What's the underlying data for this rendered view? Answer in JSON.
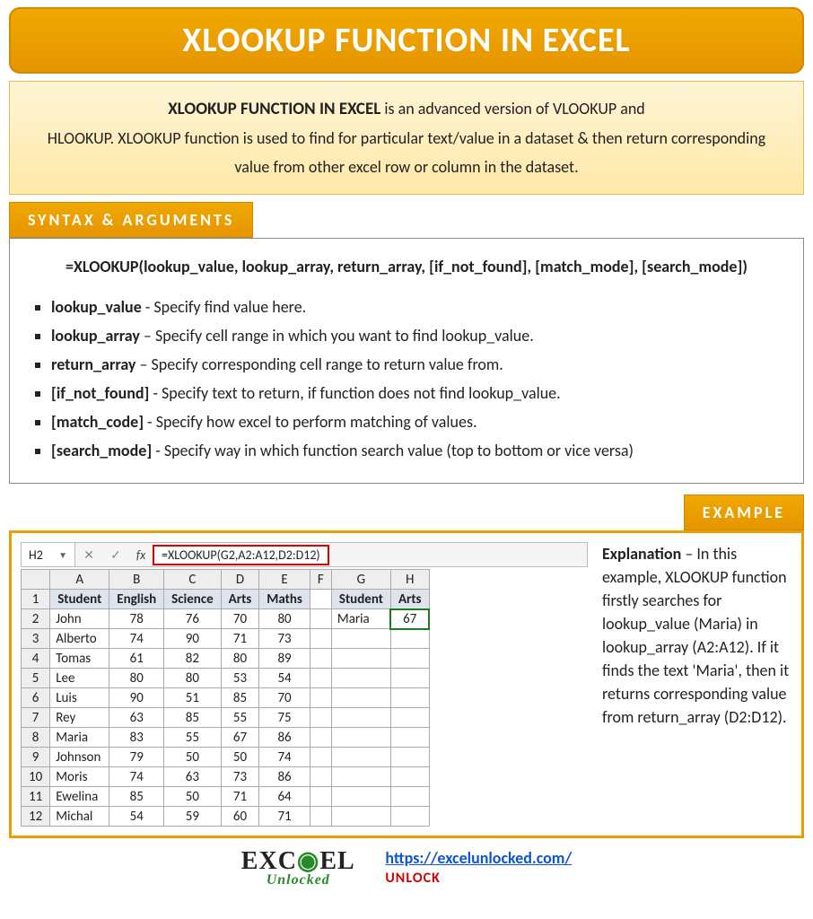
{
  "banner_title": "XLOOKUP FUNCTION IN EXCEL",
  "desc": {
    "lead": "XLOOKUP FUNCTION IN EXCEL",
    "rest1": " is an advanced version of VLOOKUP and",
    "rest2": "HLOOKUP. XLOOKUP function is used to find for particular text/value in a dataset & then return corresponding value from other excel row or column in the dataset."
  },
  "tabs": {
    "syntax": "SYNTAX & ARGUMENTS",
    "example": "EXAMPLE"
  },
  "syntax_formula": "=XLOOKUP(lookup_value, lookup_array, return_array, [if_not_found], [match_mode], [search_mode])",
  "args": [
    {
      "name": "lookup_value",
      "desc": " - Specify find value here."
    },
    {
      "name": "lookup_array",
      "desc": " – Specify cell range in which you want to find lookup_value."
    },
    {
      "name": "return_array",
      "desc": " – Specify corresponding cell range to return value from."
    },
    {
      "name": "[if_not_found]",
      "desc": " - Specify text to return, if function does not find lookup_value."
    },
    {
      "name": "[match_code]",
      "desc": " - Specify how excel to perform matching of values."
    },
    {
      "name": "[search_mode]",
      "desc": " - Specify way in which function search value (top to bottom or vice versa)"
    }
  ],
  "excel": {
    "namebox": "H2",
    "fx_label": "fx",
    "formula": "=XLOOKUP(G2,A2:A12,D2:D12)",
    "cols": [
      "A",
      "B",
      "C",
      "D",
      "E",
      "F",
      "G",
      "H"
    ],
    "head": {
      "A": "Student",
      "B": "English",
      "C": "Science",
      "D": "Arts",
      "E": "Maths",
      "G": "Student",
      "H": "Arts"
    },
    "rows": [
      {
        "n": "2",
        "A": "John",
        "B": "78",
        "C": "76",
        "D": "70",
        "E": "80",
        "G": "Maria",
        "H": "67"
      },
      {
        "n": "3",
        "A": "Alberto",
        "B": "74",
        "C": "90",
        "D": "71",
        "E": "73"
      },
      {
        "n": "4",
        "A": "Tomas",
        "B": "61",
        "C": "82",
        "D": "80",
        "E": "89"
      },
      {
        "n": "5",
        "A": "Lee",
        "B": "80",
        "C": "80",
        "D": "53",
        "E": "54"
      },
      {
        "n": "6",
        "A": "Luis",
        "B": "90",
        "C": "51",
        "D": "85",
        "E": "70"
      },
      {
        "n": "7",
        "A": "Rey",
        "B": "63",
        "C": "85",
        "D": "55",
        "E": "75"
      },
      {
        "n": "8",
        "A": "Maria",
        "B": "83",
        "C": "55",
        "D": "67",
        "E": "86"
      },
      {
        "n": "9",
        "A": "Johnson",
        "B": "79",
        "C": "50",
        "D": "50",
        "E": "74"
      },
      {
        "n": "10",
        "A": "Moris",
        "B": "74",
        "C": "63",
        "D": "73",
        "E": "86"
      },
      {
        "n": "11",
        "A": "Ewelina",
        "B": "85",
        "C": "50",
        "D": "71",
        "E": "64"
      },
      {
        "n": "12",
        "A": "Michal",
        "B": "54",
        "C": "59",
        "D": "60",
        "E": "71"
      }
    ]
  },
  "explanation": {
    "lead": "Explanation",
    "text": " – In this example, XLOOKUP function firstly searches for lookup_value (Maria) in lookup_array (A2:A12). If it finds the text 'Maria', then it returns corresponding value from return_array (D2:D12)."
  },
  "footer": {
    "brand1a": "EXC",
    "brand1b": "E",
    "brand1c": "L",
    "brand2": "Unlocked",
    "url": "https://excelunlocked.com/",
    "unlock": "UNLOCK"
  }
}
